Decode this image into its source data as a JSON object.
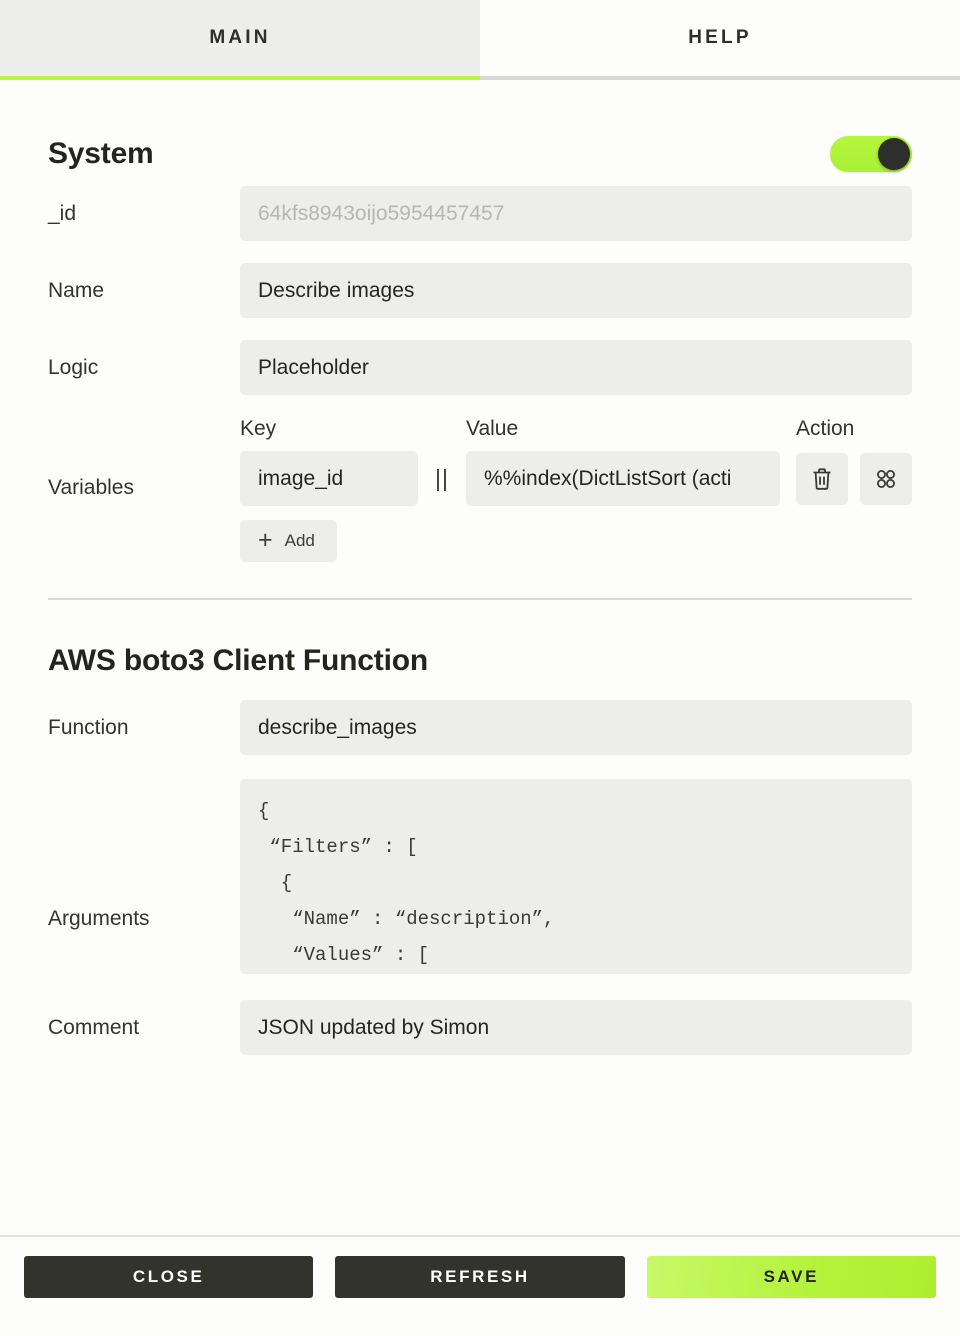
{
  "tabs": [
    {
      "label": "MAIN",
      "active": true
    },
    {
      "label": "HELP",
      "active": false
    }
  ],
  "system": {
    "title": "System",
    "toggle_on": true,
    "fields": {
      "id_label": "_id",
      "id_value": "64kfs8943oijo5954457457",
      "name_label": "Name",
      "name_value": "Describe images",
      "logic_label": "Logic",
      "logic_value": "Placeholder"
    },
    "variables": {
      "label": "Variables",
      "columns": {
        "key": "Key",
        "value": "Value",
        "action": "Action"
      },
      "drag_handle": "||",
      "rows": [
        {
          "key": "image_id",
          "value": "%%index(DictListSort (acti",
          "delete_icon": "trash-icon",
          "grid_icon": "grid-dots-icon"
        }
      ],
      "add_label": "Add",
      "add_icon": "plus-icon"
    }
  },
  "aws": {
    "title": "AWS boto3 Client Function",
    "function_label": "Function",
    "function_value": "describe_images",
    "arguments_label": "Arguments",
    "arguments_value": "{\n “Filters” : [\n  {\n   “Name” : “description”,\n   “Values” : [",
    "comment_label": "Comment",
    "comment_value": "JSON updated by Simon"
  },
  "footer": {
    "close_label": "CLOSE",
    "refresh_label": "REFRESH",
    "save_label": "SAVE"
  },
  "colors": {
    "accent_green": "#b9f53f",
    "dark_button": "#32332b",
    "field_bg": "#ededec",
    "page_bg": "#fdfdfb",
    "muted_text": "#b6b6b2"
  }
}
